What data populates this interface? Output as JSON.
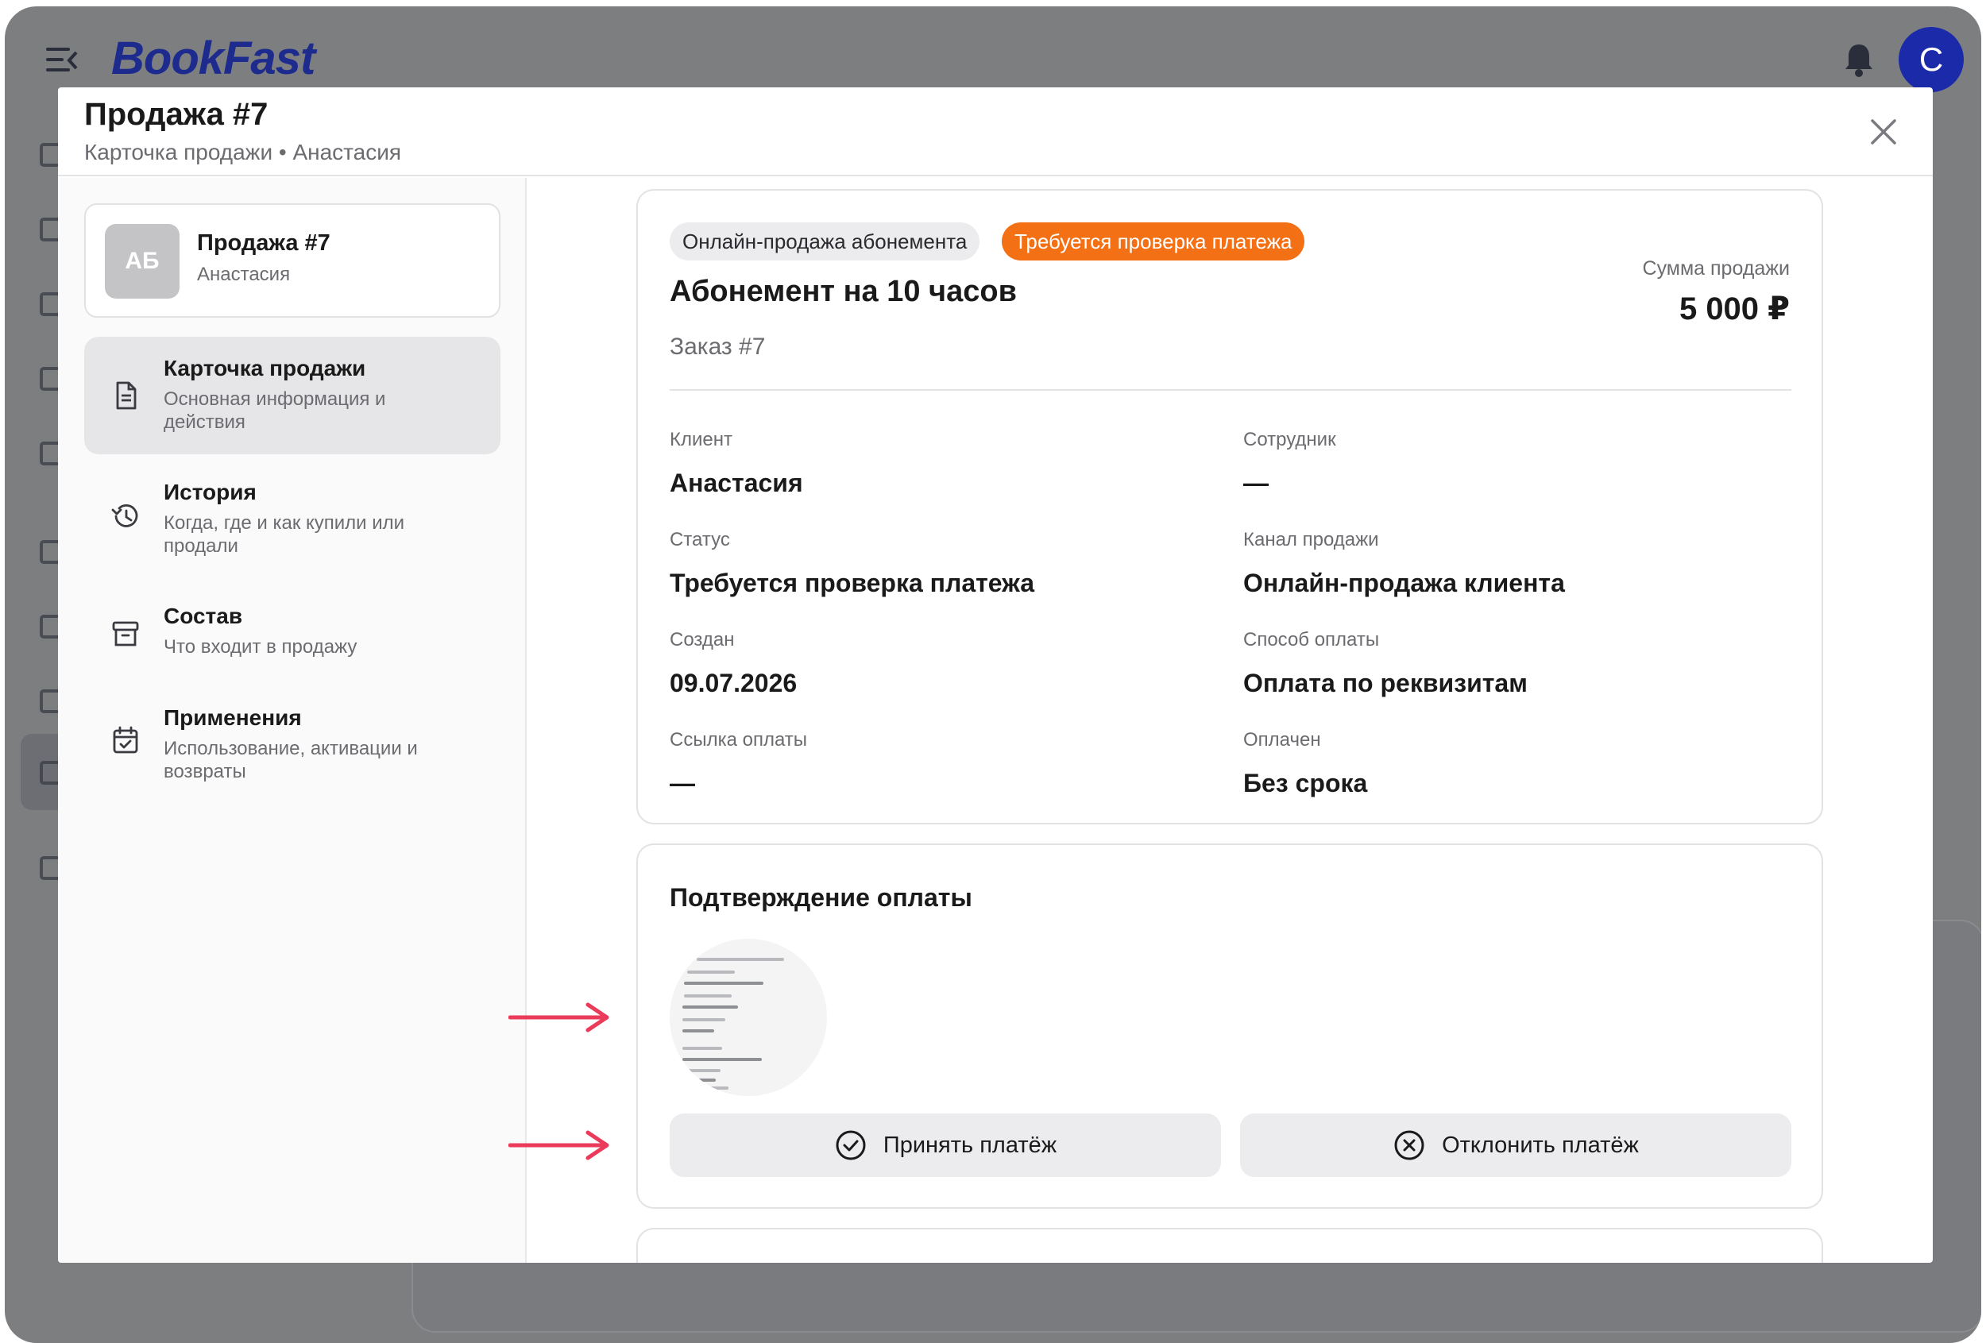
{
  "app": {
    "logo": "BookFast",
    "avatar_letter": "С"
  },
  "modal": {
    "title": "Продажа #7",
    "subtitle": "Карточка продажи • Анастасия"
  },
  "sale_card": {
    "initials": "АБ",
    "title": "Продажа #7",
    "client": "Анастасия"
  },
  "nav": [
    {
      "title": "Карточка продажи",
      "desc": "Основная информация и действия",
      "icon": "document-icon",
      "active": true
    },
    {
      "title": "История",
      "desc": "Когда, где и как купили или продали",
      "icon": "history-icon",
      "active": false
    },
    {
      "title": "Состав",
      "desc": "Что входит в продажу",
      "icon": "archive-box-icon",
      "active": false
    },
    {
      "title": "Применения",
      "desc": "Использование, активации и возвраты",
      "icon": "calendar-check-icon",
      "active": false
    }
  ],
  "details": {
    "badge_type": "Онлайн-продажа абонемента",
    "badge_status": "Требуется проверка платежа",
    "product": "Абонемент на 10 часов",
    "order": "Заказ #7",
    "sum_label": "Сумма продажи",
    "sum_value": "5 000 ₽",
    "fields": [
      {
        "label": "Клиент",
        "value": "Анастасия"
      },
      {
        "label": "Сотрудник",
        "value": "—"
      },
      {
        "label": "Статус",
        "value": "Требуется проверка платежа"
      },
      {
        "label": "Канал продажи",
        "value": "Онлайн-продажа клиента"
      },
      {
        "label": "Создан",
        "value": "09.07.2026"
      },
      {
        "label": "Способ оплаты",
        "value": "Оплата по реквизитам"
      },
      {
        "label": "Ссылка оплаты",
        "value": "—"
      },
      {
        "label": "Оплачен",
        "value": "Без срока"
      }
    ]
  },
  "confirmation": {
    "title": "Подтверждение оплаты",
    "accept_label": "Принять платёж",
    "reject_label": "Отклонить платёж"
  },
  "colors": {
    "brand": "#1d2b8e",
    "status_orange": "#f37015",
    "annotation_arrow": "#ea3b5a"
  }
}
